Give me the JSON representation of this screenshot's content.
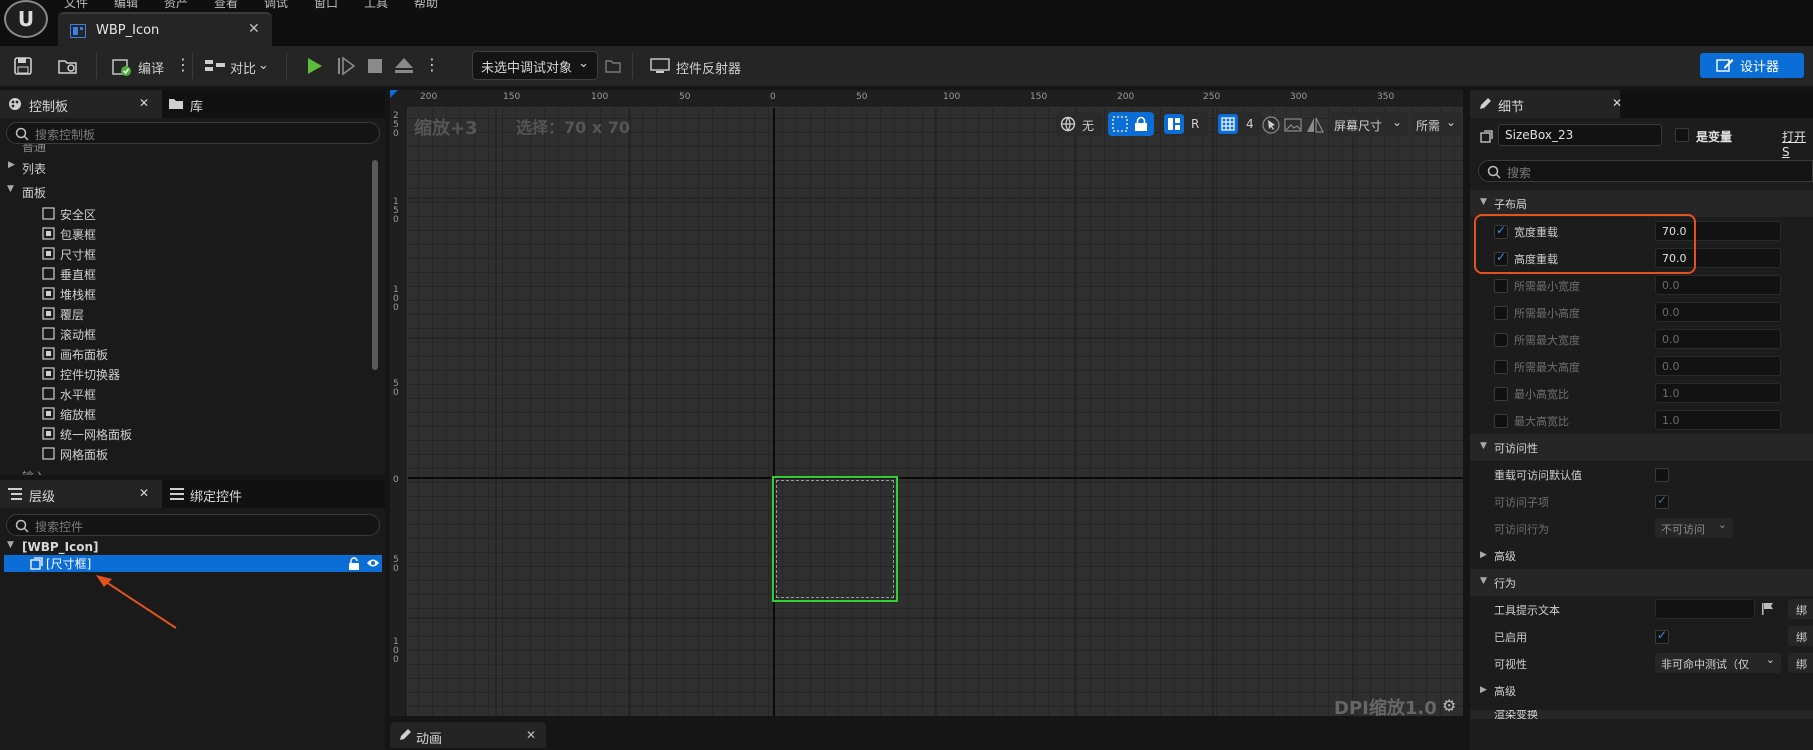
{
  "menu": [
    "文件",
    "编辑",
    "资产",
    "查看",
    "调试",
    "窗口",
    "工具",
    "帮助"
  ],
  "doc_tab": {
    "title": "WBP_Icon"
  },
  "toolbar": {
    "compile_label": "编译",
    "diff_label": "对比",
    "debug_target": "未选中调试对象",
    "widget_reflector_label": "控件反射器",
    "designer_label": "设计器"
  },
  "palette": {
    "tab_label": "控制板",
    "library_tab_label": "库",
    "search_placeholder": "搜索控制板",
    "cut_top_label": "普通",
    "categories": [
      {
        "label": "列表",
        "expanded": false
      },
      {
        "label": "面板",
        "expanded": true
      }
    ],
    "items": [
      "安全区",
      "包裹框",
      "尺寸框",
      "垂直框",
      "堆栈框",
      "覆层",
      "滚动框",
      "画布面板",
      "控件切换器",
      "水平框",
      "缩放框",
      "统一网格面板",
      "网格面板"
    ],
    "cut_bottom_label": "输入"
  },
  "hierarchy": {
    "tab_label": "层级",
    "bind_tab_label": "绑定控件",
    "search_placeholder": "搜索控件",
    "root_label": "[WBP_Icon]",
    "selected_item": "[尺寸框]"
  },
  "viewport": {
    "zoom_text": "缩放+3",
    "selection_text": "选择：70 x 70",
    "dpi_text": "DPI缩放1.0",
    "ruler_top": [
      "200",
      "150",
      "100",
      "50",
      "0",
      "50",
      "100",
      "150",
      "200",
      "250",
      "300",
      "350"
    ],
    "ruler_left": [
      "250",
      "150",
      "100",
      "50",
      "0",
      "50",
      "100"
    ],
    "chip_none": "无",
    "chip_r": "R",
    "chip_grid_num": "4",
    "chip_screen_size": "屏幕尺寸",
    "chip_desired": "所需"
  },
  "animation_tab": {
    "label": "动画"
  },
  "details": {
    "tab_label": "细节",
    "name_value": "SizeBox_23",
    "is_variable_label": "是变量",
    "open_label": "打开S",
    "search_placeholder": "搜索",
    "section_child_layout": "子布局",
    "width_override_label": "宽度重载",
    "width_override_value": "70.0",
    "height_override_label": "高度重载",
    "height_override_value": "70.0",
    "min_desired_width_label": "所需最小宽度",
    "min_desired_width_value": "0.0",
    "min_desired_height_label": "所需最小高度",
    "min_desired_height_value": "0.0",
    "max_desired_width_label": "所需最大宽度",
    "max_desired_width_value": "0.0",
    "max_desired_height_label": "所需最大高度",
    "max_desired_height_value": "0.0",
    "min_aspect_label": "最小高宽比",
    "min_aspect_value": "1.0",
    "max_aspect_label": "最大高宽比",
    "max_aspect_value": "1.0",
    "section_accessibility": "可访问性",
    "override_access_label": "重载可访问默认值",
    "access_children_label": "可访问子项",
    "access_behavior_label": "可访问行为",
    "access_behavior_value": "不可访问",
    "section_advanced_1": "高级",
    "section_behavior": "行为",
    "tooltip_label": "工具提示文本",
    "bind_label": "绑",
    "enabled_label": "已启用",
    "visibility_label": "可视性",
    "visibility_value": "非可命中测试（仅",
    "section_advanced_2": "高级",
    "section_render_cut": "渲染变换"
  },
  "colors": {
    "accent_blue": "#0a6ed6",
    "selection_green": "#2fd12f",
    "highlight_red": "#e0531f"
  }
}
